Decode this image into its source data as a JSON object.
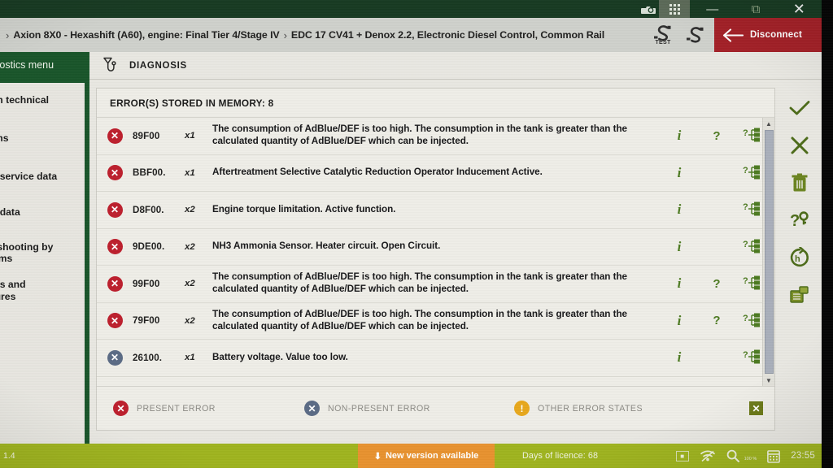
{
  "window": {
    "os_icons": [
      "camera-icon",
      "minus-icon",
      "keyboard-icon",
      "printer-icon",
      "circle-button-icon",
      "help-icon"
    ],
    "apps_grid_label": "apps-grid",
    "minimize_label": "—",
    "maximize_label": "⧉",
    "close_label": "✕"
  },
  "header": {
    "separator": "›",
    "breadcrumb": [
      "Axion 8X0 - Hexashift (A60), engine: Final Tier 4/Stage IV",
      "EDC 17 CV41 + Denox 2.2, Electronic Diesel Control, Common Rail"
    ],
    "tool_stest_label": "TEST",
    "disconnect_label": "Disconnect"
  },
  "sidebar": {
    "title": "...nostics menu",
    "items": [
      "...em technical",
      "...ams",
      "...le service data",
      "...le data",
      "...leshooting by\n...toms",
      "...ses and\n...dures"
    ]
  },
  "main": {
    "diagnosis_label": "DIAGNOSIS",
    "panel_title": "ERROR(S) STORED IN MEMORY: 8",
    "columns": [
      "status",
      "code",
      "count",
      "description",
      "actions"
    ],
    "errors": [
      {
        "status": "present",
        "code": "89F00",
        "count": "x1",
        "description": "The consumption of AdBlue/DEF is too high. The consumption in the tank is greater than the calculated quantity of AdBlue/DEF which can be injected.",
        "actions": [
          "info",
          "help",
          "tree"
        ]
      },
      {
        "status": "present",
        "code": "BBF00.",
        "count": "x1",
        "description": "Aftertreatment Selective Catalytic Reduction Operator Inducement Active.",
        "actions": [
          "info",
          "tree"
        ]
      },
      {
        "status": "present",
        "code": "D8F00.",
        "count": "x2",
        "description": "Engine torque limitation. Active function.",
        "actions": [
          "info",
          "tree"
        ]
      },
      {
        "status": "present",
        "code": "9DE00.",
        "count": "x2",
        "description": "NH3 Ammonia Sensor. Heater circuit. Open Circuit.",
        "actions": [
          "info",
          "tree"
        ]
      },
      {
        "status": "present",
        "code": "99F00",
        "count": "x2",
        "description": "The consumption of AdBlue/DEF is too high. The consumption in the tank is greater than the calculated quantity of AdBlue/DEF which can be injected.",
        "actions": [
          "info",
          "help",
          "tree"
        ]
      },
      {
        "status": "present",
        "code": "79F00",
        "count": "x2",
        "description": "The consumption of AdBlue/DEF is too high. The consumption in the tank is greater than the calculated quantity of AdBlue/DEF which can be injected.",
        "actions": [
          "info",
          "help",
          "tree"
        ]
      },
      {
        "status": "nonpresent",
        "code": "26100.",
        "count": "x1",
        "description": "Battery voltage. Value too low.",
        "actions": [
          "info",
          "tree"
        ]
      }
    ],
    "legend": [
      {
        "status": "present",
        "label": "PRESENT ERROR"
      },
      {
        "status": "nonpresent",
        "label": "NON-PRESENT ERROR"
      },
      {
        "status": "other",
        "label": "OTHER ERROR STATES"
      }
    ],
    "legend_close_label": "✕",
    "badge_glyph": "✕"
  },
  "right_toolbar": {
    "items": [
      "check-icon",
      "close-icon",
      "trash-icon",
      "question-key-icon",
      "history-refresh-icon",
      "print-icon"
    ]
  },
  "status_bar": {
    "version": "1.4",
    "new_version_label": "New version available",
    "new_version_icon": "⬇",
    "licence_label": "Days of licence: 68",
    "zoom_label": "100 %",
    "clock": "23:55"
  },
  "colors": {
    "accent_green": "#19552a",
    "status_green": "#9fb41f",
    "error_red": "#bd1f2d",
    "disconnect_red": "#a32027",
    "orange": "#e8922f",
    "nonpresent_blue": "#5b6b85",
    "other_yellow": "#e8a81c",
    "icon_green": "#586e20"
  }
}
